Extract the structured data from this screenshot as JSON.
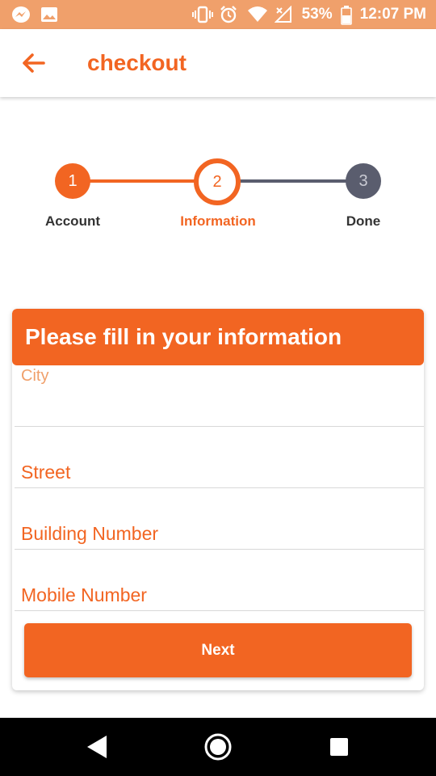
{
  "colors": {
    "accent": "#f26522",
    "status_bar": "#f0a06b",
    "inactive_step": "#5a5d6e",
    "nav_bar": "#000000"
  },
  "status_bar": {
    "battery_percent": "53%",
    "time": "12:07 PM",
    "left_icons": [
      "messenger-icon",
      "image-icon"
    ],
    "right_icons": [
      "vibrate-icon",
      "alarm-icon",
      "wifi-icon",
      "signal-icon",
      "battery-icon"
    ]
  },
  "app_bar": {
    "title": "checkout",
    "back_icon": "arrow-left-icon"
  },
  "stepper": {
    "steps": [
      {
        "number": "1",
        "label": "Account",
        "state": "completed"
      },
      {
        "number": "2",
        "label": "Information",
        "state": "active"
      },
      {
        "number": "3",
        "label": "Done",
        "state": "inactive"
      }
    ]
  },
  "form": {
    "header": "Please fill in your information",
    "city_label": "City",
    "city_value": "",
    "street_placeholder": "Street",
    "building_placeholder": "Building Number",
    "mobile_placeholder": "Mobile Number",
    "next_label": "Next"
  },
  "nav_bar": {
    "icons": [
      "back-triangle-icon",
      "home-circle-icon",
      "recents-square-icon"
    ]
  }
}
